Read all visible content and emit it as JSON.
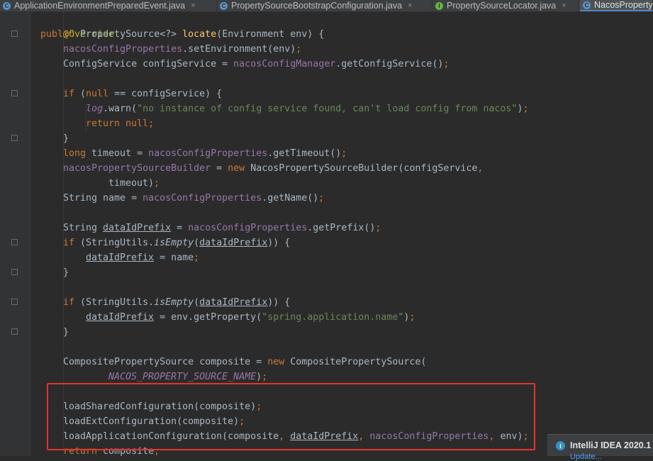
{
  "tabs": [
    {
      "label": "ApplicationEnvironmentPreparedEvent.java",
      "icon": "class-icon",
      "icon_letter": "C"
    },
    {
      "label": "PropertySourceBootstrapConfiguration.java",
      "icon": "class-icon",
      "icon_letter": "C"
    },
    {
      "label": "PropertySourceLocator.java",
      "icon": "interface-icon",
      "icon_letter": "I"
    },
    {
      "label": "NacosPropertySourceLocator.java",
      "icon": "class-icon",
      "icon_letter": "C",
      "active": true
    }
  ],
  "tab_close_glyph": "×",
  "code": {
    "l1": [
      "@Override"
    ],
    "l2": [
      "public ",
      "PropertySource<?> ",
      "locate",
      "(Environment env) {"
    ],
    "l3": [
      "nacosConfigProperties",
      ".setEnvironment(env)",
      ";"
    ],
    "l4": [
      "ConfigService configService = ",
      "nacosConfigManager",
      ".getConfigService()",
      ";"
    ],
    "l6": [
      "if ",
      "(",
      "null ",
      "== configService) {"
    ],
    "l7": [
      "log",
      ".warn(",
      "\"no instance of config service found, can't load config from nacos\"",
      ")",
      ";"
    ],
    "l8": [
      "return null",
      ";"
    ],
    "l9": [
      "}"
    ],
    "l10": [
      "long ",
      "timeout = ",
      "nacosConfigProperties",
      ".getTimeout()",
      ";"
    ],
    "l11": [
      "nacosPropertySourceBuilder",
      " = ",
      "new ",
      "NacosPropertySourceBuilder(configService",
      ","
    ],
    "l12": [
      "timeout)",
      ";"
    ],
    "l13": [
      "String name = ",
      "nacosConfigProperties",
      ".getName()",
      ";"
    ],
    "l15": [
      "String ",
      "dataIdPrefix",
      " = ",
      "nacosConfigProperties",
      ".getPrefix()",
      ";"
    ],
    "l16": [
      "if ",
      "(StringUtils.",
      "isEmpty",
      "(",
      "dataIdPrefix",
      ")) {"
    ],
    "l17": [
      "dataIdPrefix",
      " = name",
      ";"
    ],
    "l18": [
      "}"
    ],
    "l20": [
      "if ",
      "(StringUtils.",
      "isEmpty",
      "(",
      "dataIdPrefix",
      ")) {"
    ],
    "l21": [
      "dataIdPrefix",
      " = env.getProperty(",
      "\"spring.application.name\"",
      ")",
      ";"
    ],
    "l22": [
      "}"
    ],
    "l24": [
      "CompositePropertySource composite = ",
      "new ",
      "CompositePropertySource("
    ],
    "l25": [
      "NACOS_PROPERTY_SOURCE_NAME",
      ")",
      ";"
    ],
    "l27": [
      "loadSharedConfiguration(composite)",
      ";"
    ],
    "l28": [
      "loadExtConfiguration(composite)",
      ";"
    ],
    "l29": [
      "loadApplicationConfiguration(composite",
      ", ",
      "dataIdPrefix",
      ", ",
      "nacosConfigProperties",
      ", ",
      "env)",
      ";"
    ],
    "l30": [
      "return ",
      "composite",
      ";"
    ]
  },
  "notification": {
    "title": "IntelliJ IDEA 2020.1",
    "subtitle": "Update..."
  },
  "colors": {
    "background": "#2b2b2b",
    "keyword": "#cc7832",
    "field": "#9876aa",
    "method_decl": "#ffc66d",
    "string": "#6a8759",
    "annotation": "#bbb529",
    "highlight_box": "#e8322b"
  }
}
